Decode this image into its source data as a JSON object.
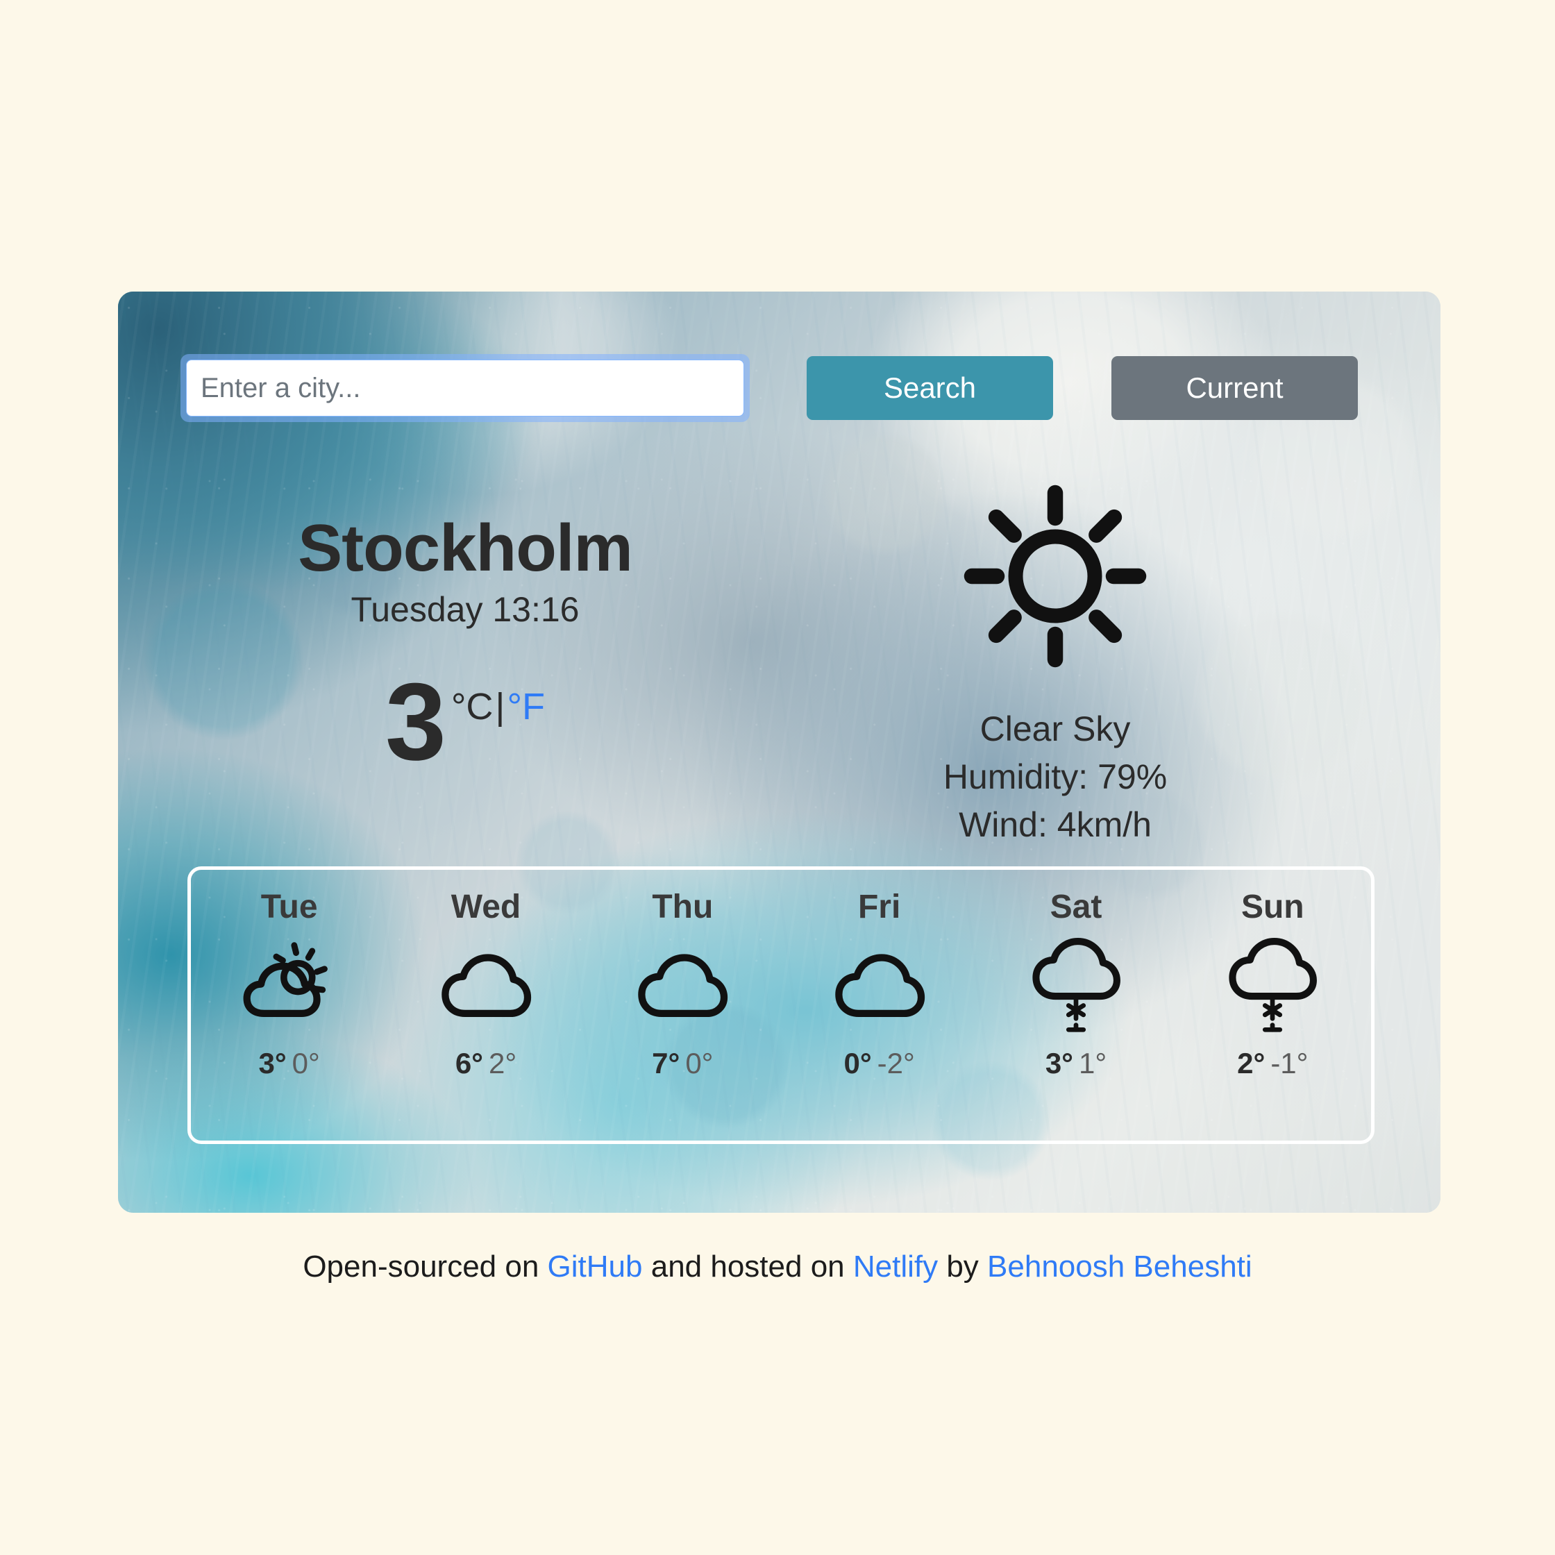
{
  "page": {
    "background_color": "#fdf8e9"
  },
  "search": {
    "placeholder": "Enter a city...",
    "value": "",
    "search_label": "Search",
    "search_color": "#3c95ab",
    "current_label": "Current",
    "current_color": "#6c757d"
  },
  "current": {
    "city": "Stockholm",
    "date_time": "Tuesday 13:16",
    "temperature": "3",
    "unit_celsius": "°C",
    "unit_separator": "|",
    "unit_fahrenheit": "°F",
    "active_unit": "celsius",
    "fahrenheit_color": "#2f7bf6",
    "icon": "sun-icon",
    "condition": "Clear Sky",
    "humidity": "Humidity: 79%",
    "wind": "Wind: 4km/h"
  },
  "forecast": [
    {
      "day": "Tue",
      "icon": "partly-cloudy-icon",
      "max": "3°",
      "min": "0°"
    },
    {
      "day": "Wed",
      "icon": "cloud-icon",
      "max": "6°",
      "min": "2°"
    },
    {
      "day": "Thu",
      "icon": "cloud-icon",
      "max": "7°",
      "min": "0°"
    },
    {
      "day": "Fri",
      "icon": "cloud-icon",
      "max": "0°",
      "min": "-2°"
    },
    {
      "day": "Sat",
      "icon": "snow-cloud-icon",
      "max": "3°",
      "min": "1°"
    },
    {
      "day": "Sun",
      "icon": "snow-cloud-icon",
      "max": "2°",
      "min": "-1°"
    }
  ],
  "footer": {
    "part1": "Open-sourced on ",
    "link_github": "GitHub",
    "part2": " and hosted on ",
    "link_netlify": "Netlify",
    "part3": " by ",
    "link_author": "Behnoosh Beheshti",
    "link_color": "#2f7bf6"
  }
}
